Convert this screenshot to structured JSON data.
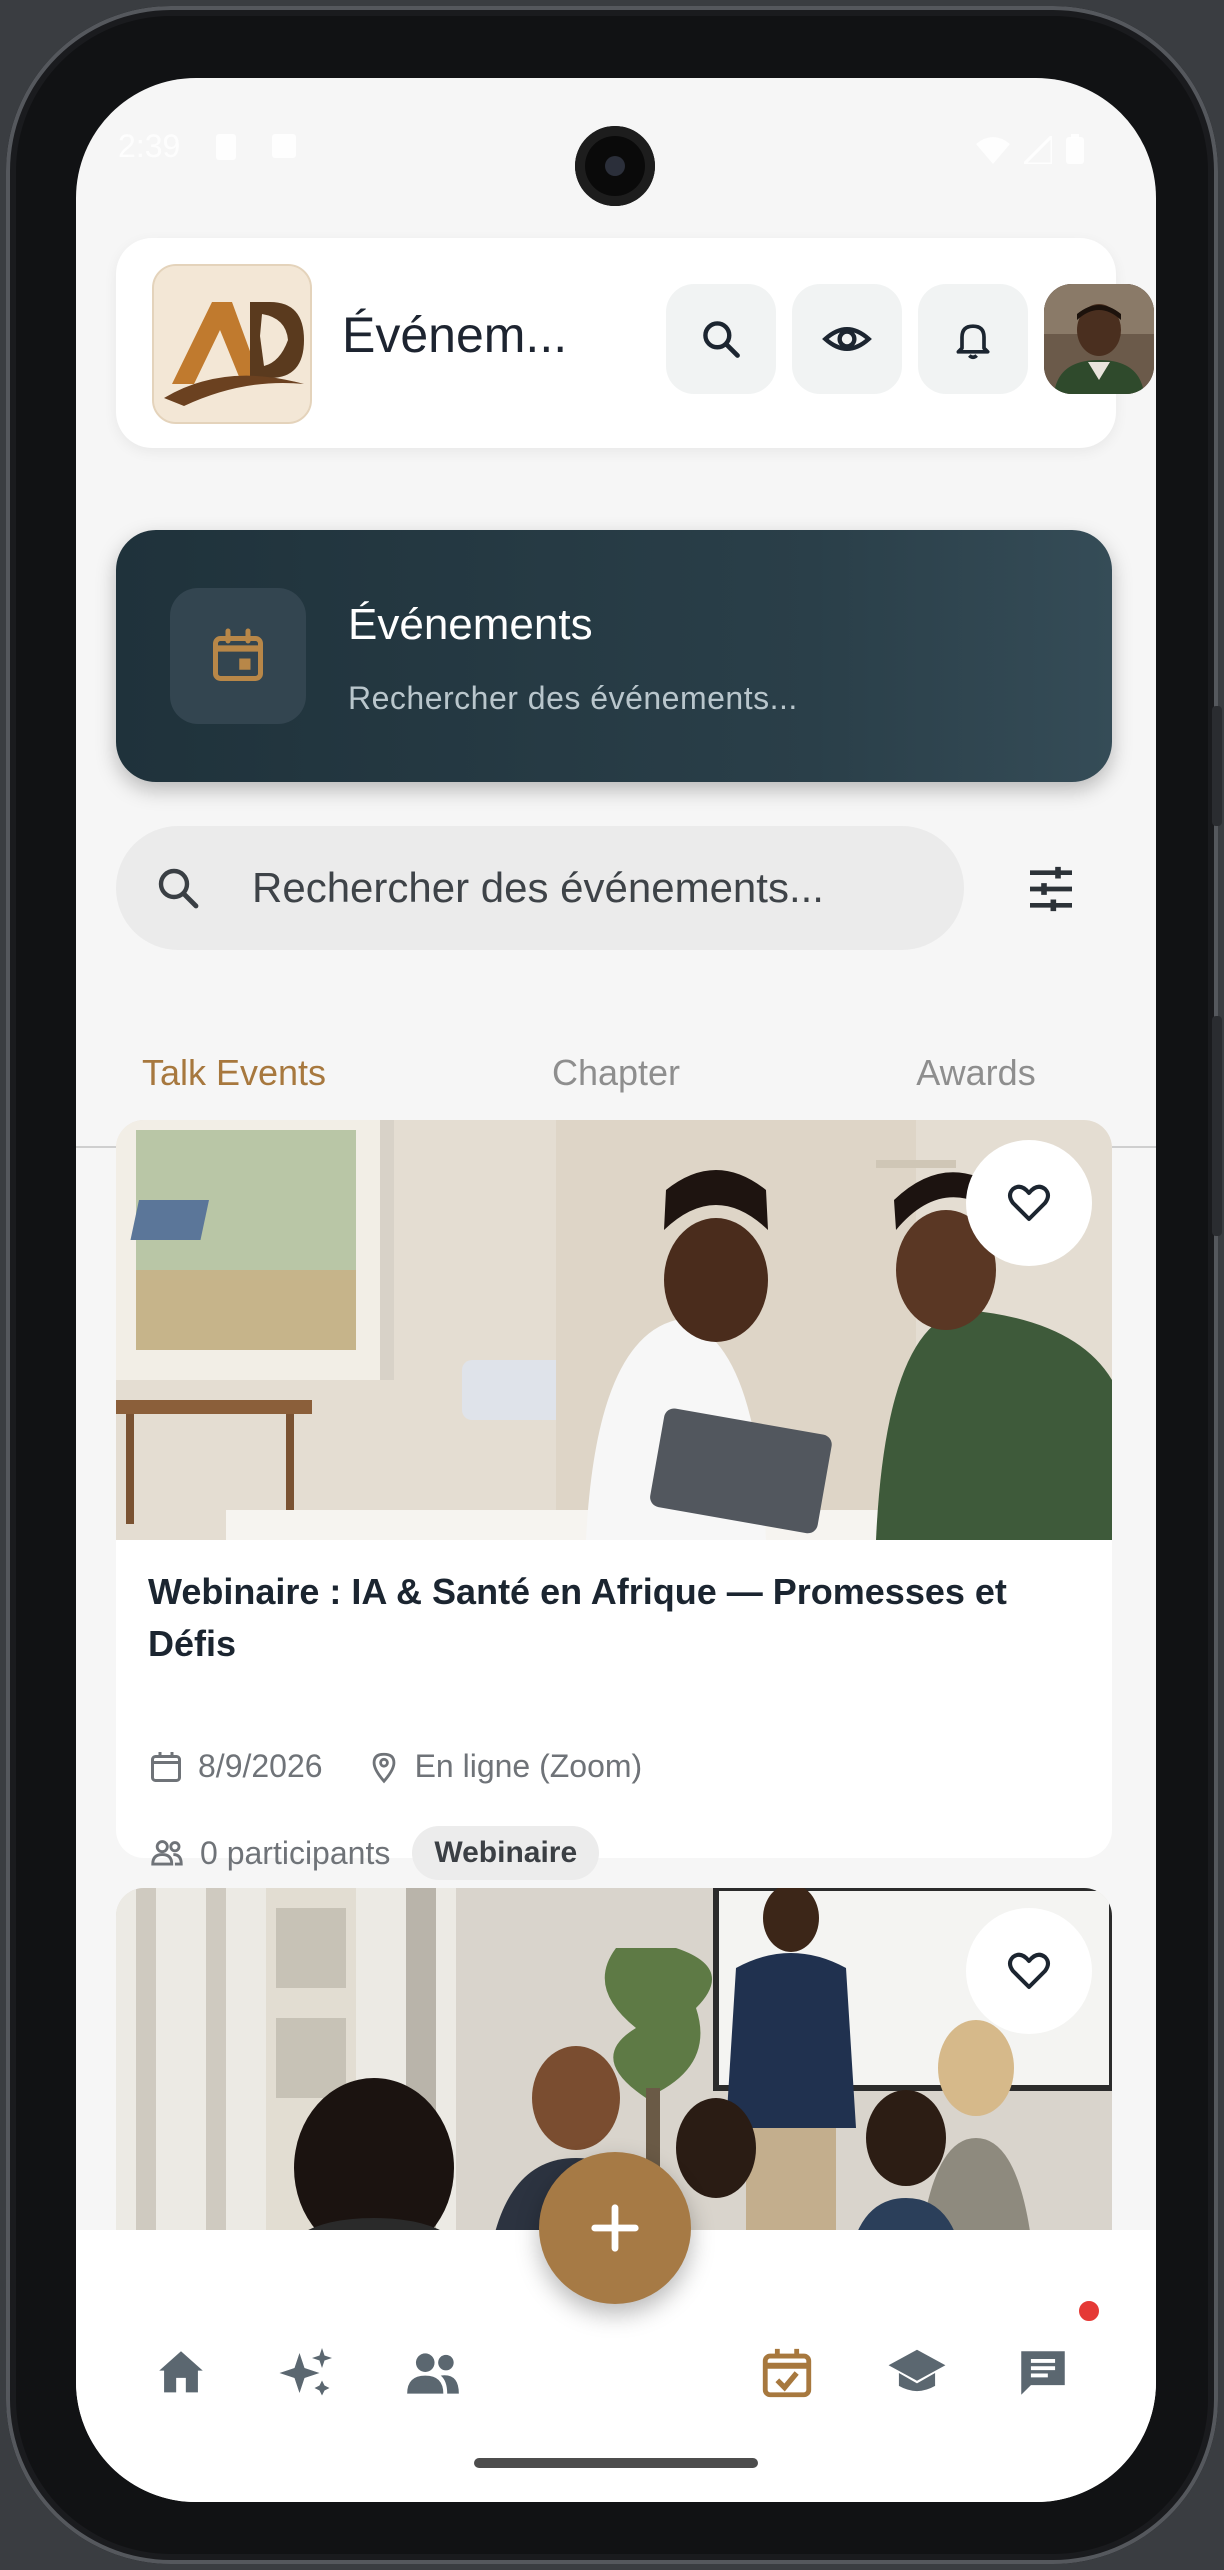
{
  "status_bar": {
    "time": "2:39"
  },
  "header": {
    "title": "Événem...",
    "logo_text": "AD"
  },
  "banner": {
    "title": "Événements",
    "subtitle": "Rechercher des événements..."
  },
  "search": {
    "placeholder": "Rechercher des événements..."
  },
  "tabs": [
    {
      "label": "Talk Events",
      "active": true
    },
    {
      "label": "Chapter",
      "active": false
    },
    {
      "label": "Awards",
      "active": false
    }
  ],
  "events": [
    {
      "title": "Webinaire : IA & Santé en Afrique — Promesses et Défis",
      "date": "8/9/2026",
      "location": "En ligne (Zoom)",
      "participants": "0 participants",
      "type": "Webinaire"
    }
  ],
  "nav": {
    "items": [
      "home-icon",
      "sparkles-icon",
      "people-icon",
      "calendar-check-icon",
      "school-icon",
      "chat-icon"
    ],
    "active": "calendar-check-icon"
  },
  "colors": {
    "accent": "#a7783e",
    "banner_bg": "#1f323b",
    "title_text": "#1b2530"
  }
}
